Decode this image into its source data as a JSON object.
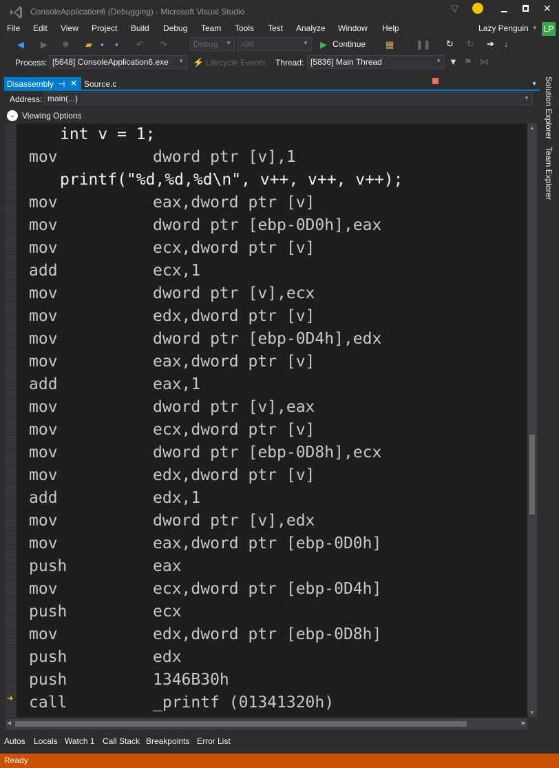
{
  "window": {
    "title": "ConsoleApplication6 (Debugging) - Microsoft Visual Studio",
    "user": "Lazy Penguin",
    "avatar": "LP"
  },
  "menu": [
    "File",
    "Edit",
    "View",
    "Project",
    "Build",
    "Debug",
    "Team",
    "Tools",
    "Test",
    "Analyze",
    "Window",
    "Help"
  ],
  "toolbar": {
    "config": "Debug",
    "platform": "x86",
    "continue_label": "Continue"
  },
  "debugbar": {
    "process_label": "Process:",
    "process_value": "[5648] ConsoleApplication6.exe",
    "lifecycle": "Lifecycle Events",
    "thread_label": "Thread:",
    "thread_value": "[5836] Main Thread"
  },
  "tabs": {
    "active": "Disassembly",
    "other": "Source.c"
  },
  "address": {
    "label": "Address:",
    "value": "main(...)"
  },
  "viewing_options": "Viewing Options",
  "code": [
    {
      "src": "int v = 1;"
    },
    {
      "mn": "mov",
      "op": "dword ptr [v],1"
    },
    {
      "src": "printf(\"%d,%d,%d\\n\", v++, v++, v++);"
    },
    {
      "mn": "mov",
      "op": "eax,dword ptr [v]"
    },
    {
      "mn": "mov",
      "op": "dword ptr [ebp-0D0h],eax"
    },
    {
      "mn": "mov",
      "op": "ecx,dword ptr [v]"
    },
    {
      "mn": "add",
      "op": "ecx,1"
    },
    {
      "mn": "mov",
      "op": "dword ptr [v],ecx"
    },
    {
      "mn": "mov",
      "op": "edx,dword ptr [v]"
    },
    {
      "mn": "mov",
      "op": "dword ptr [ebp-0D4h],edx"
    },
    {
      "mn": "mov",
      "op": "eax,dword ptr [v]"
    },
    {
      "mn": "add",
      "op": "eax,1"
    },
    {
      "mn": "mov",
      "op": "dword ptr [v],eax"
    },
    {
      "mn": "mov",
      "op": "ecx,dword ptr [v]"
    },
    {
      "mn": "mov",
      "op": "dword ptr [ebp-0D8h],ecx"
    },
    {
      "mn": "mov",
      "op": "edx,dword ptr [v]"
    },
    {
      "mn": "add",
      "op": "edx,1"
    },
    {
      "mn": "mov",
      "op": "dword ptr [v],edx"
    },
    {
      "mn": "mov",
      "op": "eax,dword ptr [ebp-0D0h]"
    },
    {
      "mn": "push",
      "op": "eax"
    },
    {
      "mn": "mov",
      "op": "ecx,dword ptr [ebp-0D4h]"
    },
    {
      "mn": "push",
      "op": "ecx"
    },
    {
      "mn": "mov",
      "op": "edx,dword ptr [ebp-0D8h]"
    },
    {
      "mn": "push",
      "op": "edx"
    },
    {
      "mn": "push",
      "op": "1346B30h"
    },
    {
      "mn": "call",
      "op": "_printf (01341320h)",
      "current": true
    }
  ],
  "side_tabs": [
    "Solution Explorer",
    "Team Explorer"
  ],
  "bottom_tabs": [
    "Autos",
    "Locals",
    "Watch 1",
    "Call Stack",
    "Breakpoints",
    "Error List"
  ],
  "status": "Ready",
  "colors": {
    "accent": "#007acc",
    "status": "#ca5100",
    "editor_bg": "#1e1e1e"
  }
}
